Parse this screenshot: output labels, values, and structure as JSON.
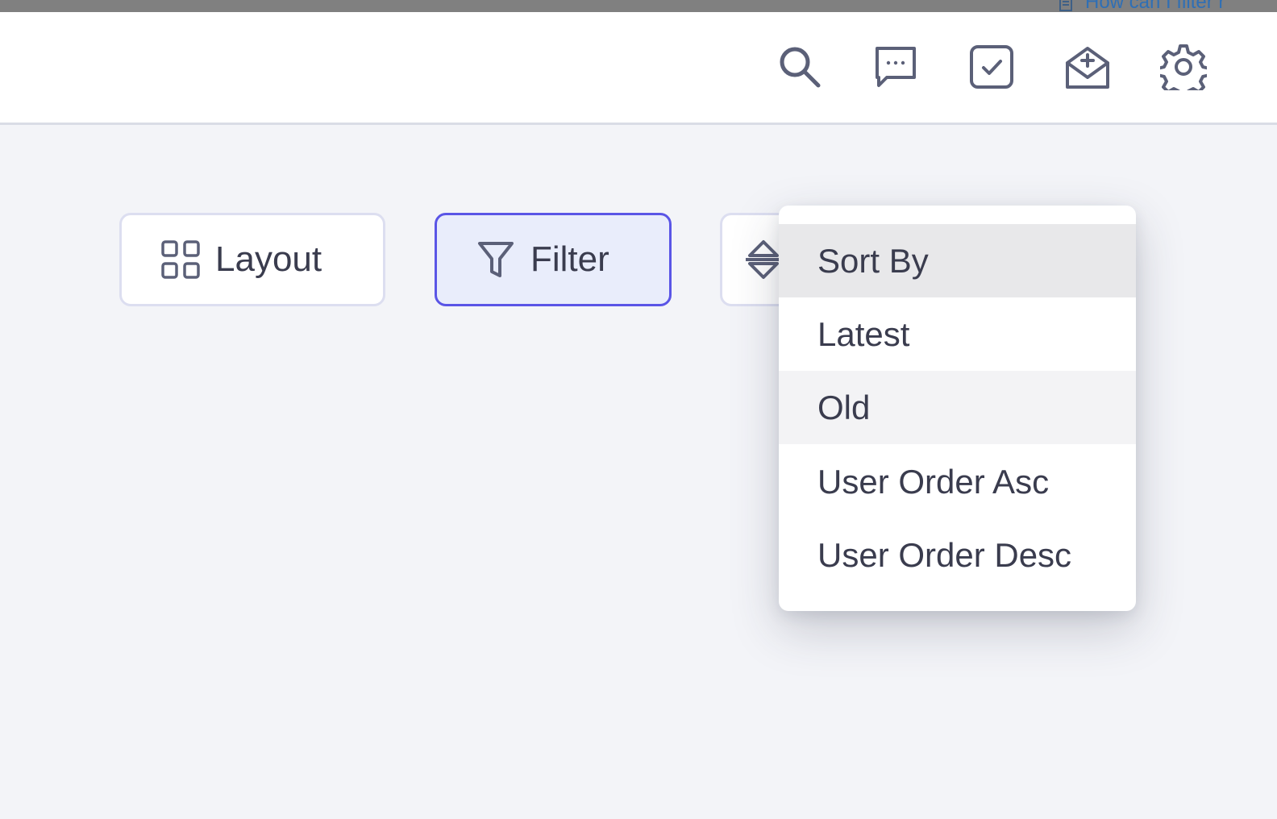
{
  "browser_hint": {
    "text": "How can I filter r",
    "icon": "document-icon"
  },
  "header": {
    "icons": [
      "search-icon",
      "chat-icon",
      "task-check-icon",
      "mail-open-icon",
      "gear-icon"
    ]
  },
  "toolbar": {
    "layout_label": "Layout",
    "filter_label": "Filter"
  },
  "sort_dropdown": {
    "items": [
      "Sort By",
      "Latest",
      "Old",
      "User Order Asc",
      "User Order Desc"
    ]
  },
  "colors": {
    "accent": "#5a55e6",
    "filter_bg": "#e9edfb",
    "icon": "#5b6078",
    "page_bg": "#f3f4f8"
  }
}
